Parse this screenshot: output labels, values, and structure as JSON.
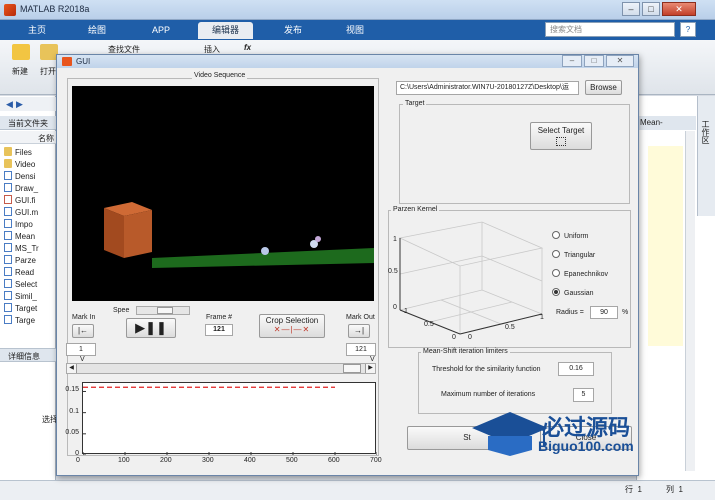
{
  "matlab": {
    "title": "MATLAB R2018a",
    "tabs": [
      "主页",
      "绘图",
      "APP",
      "编辑器",
      "发布",
      "视图"
    ],
    "active_tab": "编辑器",
    "search_placeholder": "搜索文档",
    "ribbon": {
      "new_label": "新建",
      "open_label": "打开",
      "find_files_label": "查找文件",
      "insert_label": "插入",
      "fx_label": "fx"
    },
    "current_folder_label": "当前文件夹",
    "name_header": "名称",
    "files": [
      "Files",
      "Video",
      "Densi",
      "Draw_",
      "GUI.fi",
      "GUI.m",
      "Impo",
      "Mean",
      "MS_Tr",
      "Parze",
      "Read",
      "Select",
      "Simil_",
      "Target",
      "Targe"
    ],
    "details_label": "详细信息",
    "left_body_text": "选择",
    "right_header": "Mean-",
    "workspace_label": "工作区",
    "status_row_label": "行",
    "status_row_value": "1",
    "status_col_label": "列",
    "status_col_value": "1"
  },
  "gui": {
    "title": "GUI",
    "video_sequence_label": "Video Sequence",
    "mark_in_label": "Mark In",
    "speed_label": "Spee",
    "frame_label": "Frame #",
    "frame_value": "121",
    "crop_label": "Crop Selection",
    "mark_out_label": "Mark Out",
    "mark_in_value": "1",
    "mark_out_value": "121",
    "path_value": "C:\\Users\\Administrator.WIN7U-20180127Z\\Desktop\\运",
    "browse_label": "Browse",
    "target_label": "Target",
    "select_target_label": "Select Target",
    "parzen_label": "Parzen Kernel",
    "kernels": [
      {
        "label": "Uniform",
        "selected": false
      },
      {
        "label": "Triangular",
        "selected": false
      },
      {
        "label": "Epanechnikov",
        "selected": false
      },
      {
        "label": "Gaussian",
        "selected": true
      }
    ],
    "radius_label": "Radius =",
    "radius_value": "90",
    "radius_unit": "%",
    "meanshift_label": "Mean-Shift iteration limiters",
    "threshold_label": "Threshold for the similarity function",
    "threshold_value": "0.16",
    "max_iter_label": "Maximum number of iterations",
    "max_iter_value": "5",
    "start_label": "St",
    "close_label": "Close",
    "kernel_plot_ticks": {
      "z": [
        "1",
        "0.5",
        "0"
      ],
      "x": [
        "0",
        "0.5",
        "1"
      ],
      "y": [
        "0",
        "0.5",
        "1"
      ]
    }
  },
  "chart_data": {
    "type": "line",
    "title": "",
    "xlabel": "",
    "ylabel": "",
    "xlim": [
      0,
      700
    ],
    "ylim": [
      0,
      0.17
    ],
    "x_ticks": [
      "0",
      "100",
      "200",
      "300",
      "400",
      "500",
      "600",
      "700"
    ],
    "y_ticks": [
      "0",
      "0.05",
      "0.1",
      "0.15"
    ],
    "series": [
      {
        "style": "dashed",
        "color": "#e02020",
        "x": [
          0,
          600
        ],
        "y": [
          0.16,
          0.16
        ]
      }
    ]
  },
  "watermark": {
    "line1": "必过源码",
    "line2": "Biguo100.com"
  },
  "colors": {
    "accent": "#1f5ea8",
    "box": "#b85a2a",
    "ground": "#1d6a1d"
  }
}
